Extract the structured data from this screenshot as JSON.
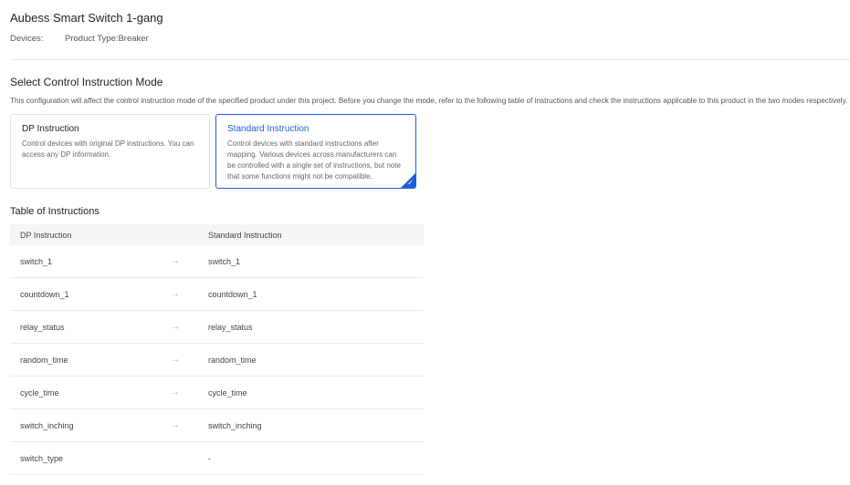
{
  "header": {
    "title": "Aubess Smart Switch 1-gang",
    "devices_label": "Devices:",
    "product_type": "Product Type:Breaker"
  },
  "mode_section": {
    "title": "Select Control Instruction Mode",
    "description": "This configuration will affect the control instruction mode of the specified product under this project. Before you change the mode, refer to the following table of instructions and check the instructions applicable to this product in the two modes respectively.",
    "cards": [
      {
        "title": "DP Instruction",
        "description": "Control devices with original DP instructions. You can access any DP information.",
        "selected": false
      },
      {
        "title": "Standard Instruction",
        "description": "Control devices with standard instructions after mapping. Various devices across manufacturers can be controlled with a single set of instructions, but note that some functions might not be compatible.",
        "selected": true
      }
    ]
  },
  "table": {
    "title": "Table of Instructions",
    "columns": [
      "DP Instruction",
      "Standard Instruction"
    ],
    "rows": [
      {
        "dp": "switch_1",
        "arrow": "→",
        "std": "switch_1"
      },
      {
        "dp": "countdown_1",
        "arrow": "→",
        "std": "countdown_1"
      },
      {
        "dp": "relay_status",
        "arrow": "→",
        "std": "relay_status"
      },
      {
        "dp": "random_time",
        "arrow": "→",
        "std": "random_time"
      },
      {
        "dp": "cycle_time",
        "arrow": "→",
        "std": "cycle_time"
      },
      {
        "dp": "switch_inching",
        "arrow": "→",
        "std": "switch_inching"
      },
      {
        "dp": "switch_type",
        "arrow": "",
        "std": "-"
      }
    ]
  },
  "colors": {
    "accent": "#1f5fd6",
    "border": "#e3e3e3",
    "header_bg": "#f5f5f5"
  }
}
